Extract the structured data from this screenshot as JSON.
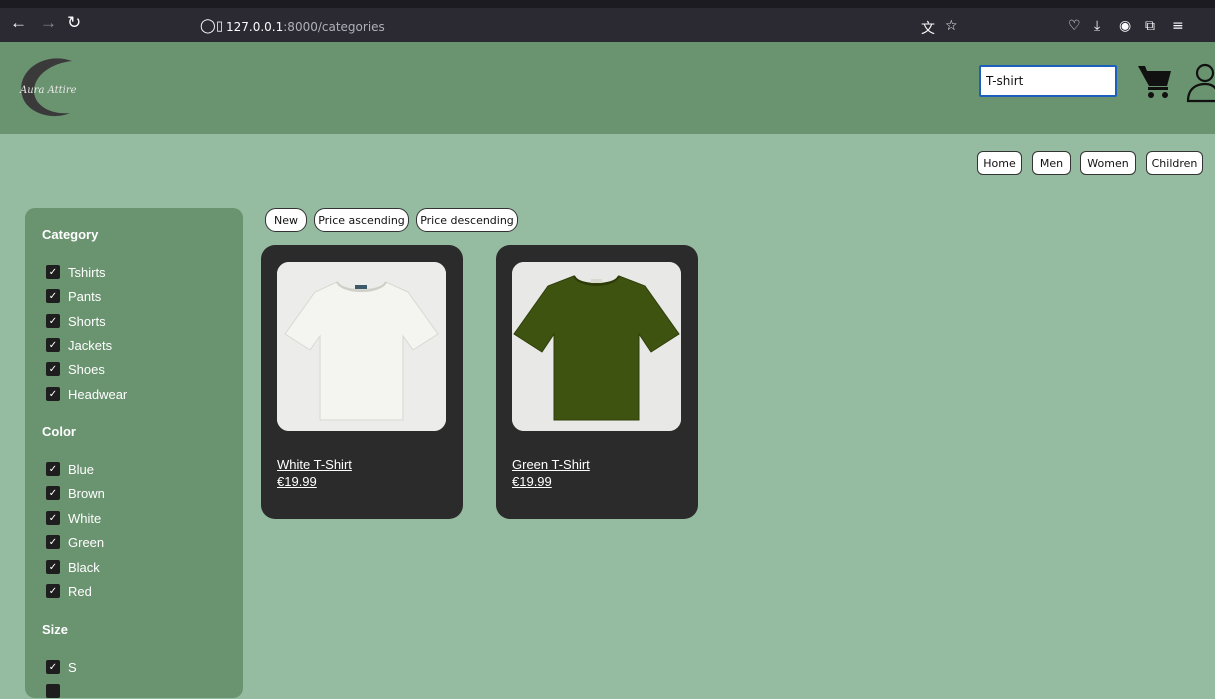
{
  "browser": {
    "url_host": "127.0.0.1",
    "url_path": ":8000/categories"
  },
  "header": {
    "logo_text": "Aura Attire",
    "search_value": "T-shirt"
  },
  "nav": {
    "items": [
      "Home",
      "Men",
      "Women",
      "Children"
    ]
  },
  "sort": {
    "new": "New",
    "price_asc": "Price ascending",
    "price_desc": "Price descending"
  },
  "filters": {
    "category": {
      "title": "Category",
      "items": [
        "Tshirts",
        "Pants",
        "Shorts",
        "Jackets",
        "Shoes",
        "Headwear"
      ]
    },
    "color": {
      "title": "Color",
      "items": [
        "Blue",
        "Brown",
        "White",
        "Green",
        "Black",
        "Red"
      ]
    },
    "size": {
      "title": "Size",
      "items": [
        "S"
      ]
    },
    "check_mark": "✓"
  },
  "products": [
    {
      "name": "White T-Shirt",
      "price": "€19.99",
      "shirt_color": "#f0f0ec",
      "bg_color": "#ececea"
    },
    {
      "name": "Green T-Shirt",
      "price": "€19.99",
      "shirt_color": "#3f5310",
      "bg_color": "#e8e8e6"
    }
  ],
  "colors": {
    "page_bg": "#95bba0",
    "header_bg": "#6a9370",
    "card_bg": "#2b2b2b"
  }
}
